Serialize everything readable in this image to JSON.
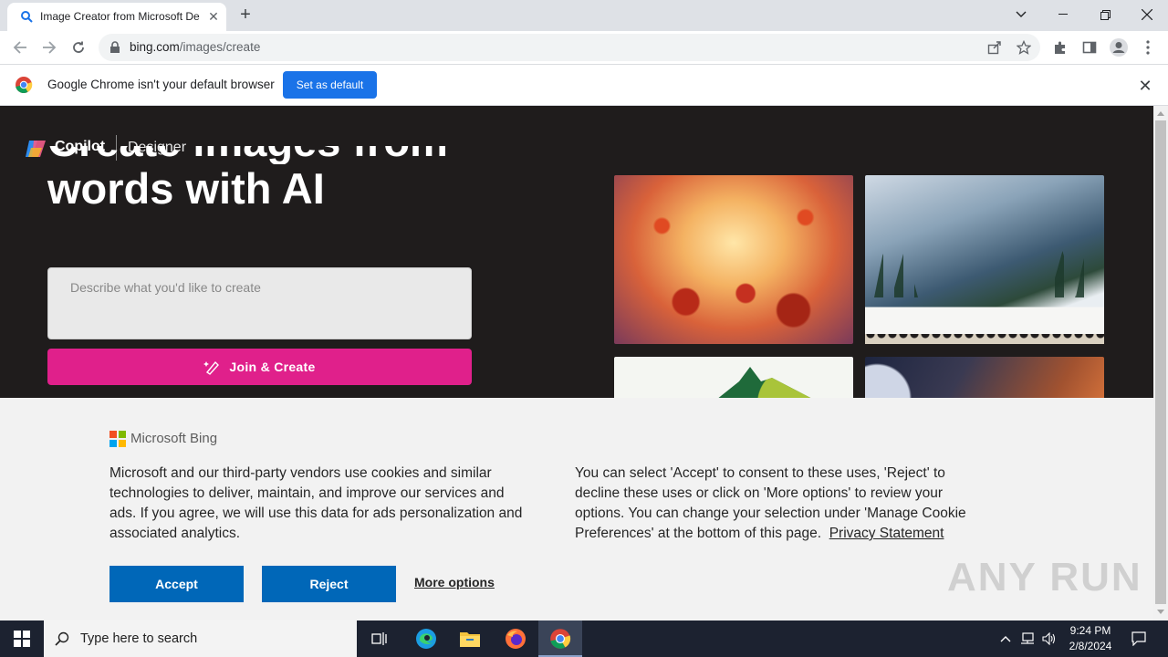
{
  "browser": {
    "tab_title": "Image Creator from Microsoft De",
    "url_host": "bing.com",
    "url_path": "/images/create"
  },
  "infobar": {
    "message": "Google Chrome isn't your default browser",
    "button": "Set as default"
  },
  "page": {
    "brand": "Copilot",
    "brand_sub": "Designer",
    "hero_line1": "Create images from",
    "hero_line2": "words with AI",
    "prompt_placeholder": "Describe what you'd like to create",
    "create_button": "Join & Create"
  },
  "cookie": {
    "company": "Microsoft Bing",
    "left_text": "Microsoft and our third-party vendors use cookies and similar technologies to deliver, maintain, and improve our services and ads. If you agree, we will use this data for ads personalization and associated analytics.",
    "right_text": "You can select 'Accept' to consent to these uses, 'Reject' to decline these uses or click on 'More options' to review your options. You can change your selection under 'Manage Cookie Preferences' at the bottom of this page.",
    "privacy_link": "Privacy Statement",
    "accept": "Accept",
    "reject": "Reject",
    "more_options": "More options",
    "watermark": "ANY RUN"
  },
  "taskbar": {
    "search_placeholder": "Type here to search",
    "time": "9:24 PM",
    "date": "2/8/2024"
  },
  "colors": {
    "accent_pink": "#e0208b",
    "ms_blue": "#0067b8",
    "chrome_blue": "#1a73e8"
  }
}
